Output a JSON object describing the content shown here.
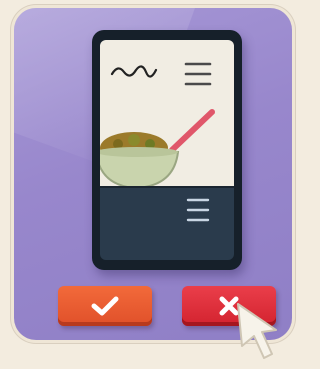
{
  "illustration": {
    "card_color": "#9a89cd",
    "confirm_button": {
      "icon": "checkmark-icon",
      "color": "#e8582f"
    },
    "reject_button": {
      "icon": "x-icon",
      "color": "#db2d38"
    },
    "cursor": {
      "icon": "pointer-cursor-icon"
    }
  }
}
